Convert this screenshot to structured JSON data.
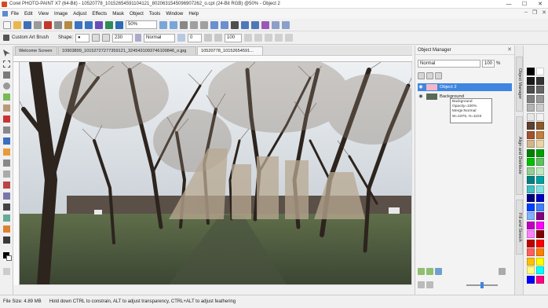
{
  "window": {
    "title": "Corel PHOTO-PAINT X7 (64-Bit) - 10520778_10152654591104121_8020631545096907262_o.cpt (24-Bit RGB) @50% - Object 2",
    "minimize": "—",
    "maximize": "☐",
    "close": "✕"
  },
  "menu": [
    "File",
    "Edit",
    "View",
    "Image",
    "Adjust",
    "Effects",
    "Mask",
    "Object",
    "Tools",
    "Window",
    "Help"
  ],
  "toolbar": {
    "zoom_value": "50%"
  },
  "property_bar": {
    "brush_label": "Custom Art Brush",
    "shape_label": "Shape:",
    "size_value": "230",
    "merge_mode": "Normal",
    "transparency_value": "0",
    "opacity_value": "100"
  },
  "tabs": [
    {
      "label": "Welcome Screen"
    },
    {
      "label": "10903899_10152727277359121_3245431093746109846_o.jpg"
    },
    {
      "label": "10520778_10152654591..."
    }
  ],
  "object_manager": {
    "title": "Object Manager",
    "merge_mode": "Normal",
    "opacity": "100",
    "opacity_unit": "%",
    "objects": [
      {
        "name": "Object 2",
        "selected": true
      },
      {
        "name": "Background",
        "selected": false
      }
    ],
    "tooltip": {
      "line1": "Background",
      "line2": "Opacity=100%",
      "line3": "Merge:Normal",
      "line4": "W=1975, H=1103"
    }
  },
  "docker_tabs": [
    "Object Manager",
    "Align and Distribute",
    "Fill and Stretch"
  ],
  "palette_colors": [
    "#000000",
    "#ffffff",
    "#1a1a1a",
    "#333333",
    "#4d4d4d",
    "#666666",
    "#808080",
    "#999999",
    "#b3b3b3",
    "#cccccc",
    "#e6e6e6",
    "#f2f2f2",
    "#5c4033",
    "#8b5a2b",
    "#a0522d",
    "#c08040",
    "#d2b48c",
    "#e8d5a8",
    "#008000",
    "#00a000",
    "#00c000",
    "#60c060",
    "#90d090",
    "#c0e8c0",
    "#008080",
    "#00a0a0",
    "#40c0c0",
    "#80e0e0",
    "#000080",
    "#0000c0",
    "#0040ff",
    "#4080ff",
    "#80b0ff",
    "#800080",
    "#c000c0",
    "#ff00ff",
    "#ff80ff",
    "#800000",
    "#c00000",
    "#ff0000",
    "#ff6060",
    "#ff8000",
    "#ffc000",
    "#ffff00",
    "#ffff80",
    "#00ffff",
    "#0000ff",
    "#ff0080"
  ],
  "status": {
    "file_size": "File Size: 4.89 MB",
    "hint": "Hold down CTRL to constrain, ALT to adjust transparency, CTRL+ALT to adjust feathering"
  }
}
